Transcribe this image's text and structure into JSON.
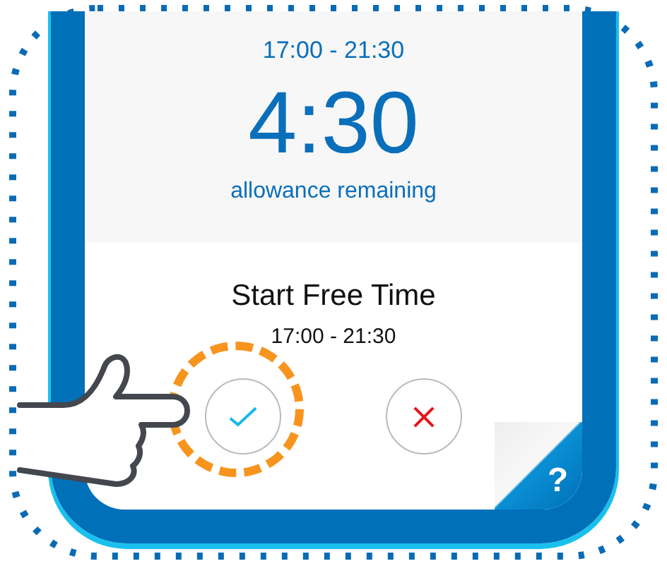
{
  "time_range": "17:00 - 21:30",
  "allowance": {
    "value": "4:30",
    "label": "allowance remaining"
  },
  "prompt": {
    "title": "Start Free Time",
    "time_range": "17:00 - 21:30"
  },
  "buttons": [
    {
      "kind": "confirm",
      "highlighted": true
    },
    {
      "kind": "cancel",
      "highlighted": false
    }
  ],
  "help": {
    "label": "?"
  }
}
